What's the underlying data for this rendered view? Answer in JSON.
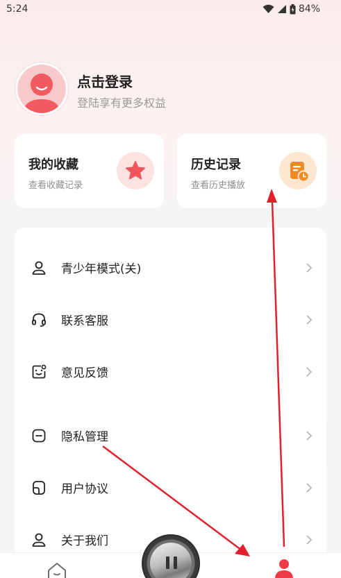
{
  "status_bar": {
    "time": "5:24",
    "battery_percent": "84%",
    "icons": [
      "wifi-icon",
      "cellular-signal-icon",
      "battery-icon"
    ]
  },
  "profile": {
    "title": "点击登录",
    "subtitle": "登陆享有更多权益"
  },
  "cards": {
    "favorites": {
      "title": "我的收藏",
      "subtitle": "查看收藏记录",
      "icon": "star-icon",
      "icon_color": "#f0545d"
    },
    "history": {
      "title": "历史记录",
      "subtitle": "查看历史播放",
      "icon": "history-clock-icon",
      "icon_color": "#f08a24"
    }
  },
  "menu": {
    "items": [
      {
        "label": "青少年模式(关)",
        "icon": "youth-mode-icon"
      },
      {
        "label": "联系客服",
        "icon": "headset-icon"
      },
      {
        "label": "意见反馈",
        "icon": "feedback-icon"
      },
      {
        "label": "隐私管理",
        "icon": "privacy-icon"
      },
      {
        "label": "用户协议",
        "icon": "user-agreement-icon"
      },
      {
        "label": "关于我们",
        "icon": "about-us-icon"
      }
    ]
  },
  "bottom_nav": {
    "items": [
      "home-icon",
      "player-disc",
      "profile-icon"
    ],
    "active_color": "#ee3b45"
  },
  "colors": {
    "accent_red": "#ee3b45",
    "annotation_arrow": "#e0202a"
  }
}
